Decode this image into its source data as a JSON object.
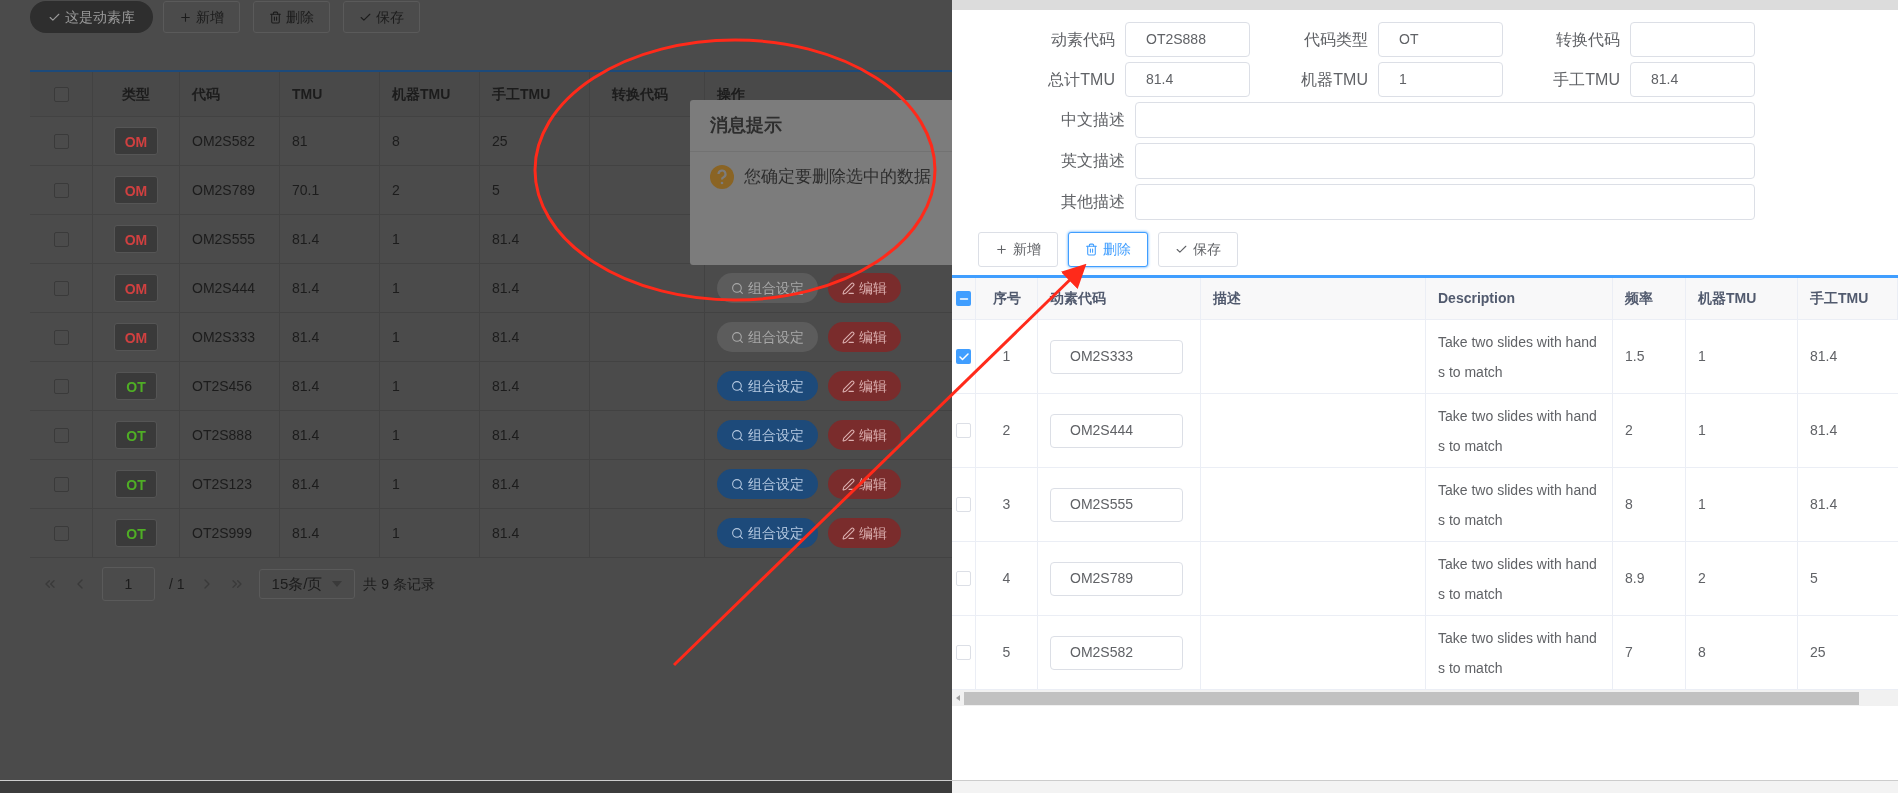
{
  "toolbar": {
    "buttons": [
      {
        "kind": "library",
        "label": "这是动素库"
      },
      {
        "kind": "add",
        "label": "新增"
      },
      {
        "kind": "delete",
        "label": "删除"
      },
      {
        "kind": "save",
        "label": "保存"
      }
    ]
  },
  "table": {
    "header_checked": false,
    "columns": [
      "类型",
      "代码",
      "TMU",
      "机器TMU",
      "手工TMU",
      "转换代码",
      "操作"
    ],
    "rows": [
      {
        "checked": false,
        "type": {
          "label": "OM",
          "color": "#d04040"
        },
        "code": "OM2S582",
        "tmu": "81",
        "machine_tmu": "8",
        "manual_tmu": "25"
      },
      {
        "checked": false,
        "type": {
          "label": "OM",
          "color": "#d04040"
        },
        "code": "OM2S789",
        "tmu": "70.1",
        "machine_tmu": "2",
        "manual_tmu": "5"
      },
      {
        "checked": false,
        "type": {
          "label": "OM",
          "color": "#d04040"
        },
        "code": "OM2S555",
        "tmu": "81.4",
        "machine_tmu": "1",
        "manual_tmu": "81.4"
      },
      {
        "checked": false,
        "type": {
          "label": "OM",
          "color": "#d04040"
        },
        "code": "OM2S444",
        "tmu": "81.4",
        "machine_tmu": "1",
        "manual_tmu": "81.4",
        "actions": [
          {
            "kind": "combo",
            "label": "组合设定",
            "disabled": true
          },
          {
            "kind": "edit",
            "label": "编辑"
          }
        ]
      },
      {
        "checked": false,
        "type": {
          "label": "OM",
          "color": "#d04040"
        },
        "code": "OM2S333",
        "tmu": "81.4",
        "machine_tmu": "1",
        "manual_tmu": "81.4",
        "actions": [
          {
            "kind": "combo",
            "label": "组合设定",
            "disabled": true
          },
          {
            "kind": "edit",
            "label": "编辑"
          }
        ]
      },
      {
        "checked": false,
        "type": {
          "label": "OT",
          "color": "#4fae25"
        },
        "code": "OT2S456",
        "tmu": "81.4",
        "machine_tmu": "1",
        "manual_tmu": "81.4",
        "actions": [
          {
            "kind": "combo",
            "label": "组合设定",
            "disabled": false
          },
          {
            "kind": "edit",
            "label": "编辑"
          }
        ]
      },
      {
        "checked": false,
        "type": {
          "label": "OT",
          "color": "#4fae25"
        },
        "code": "OT2S888",
        "tmu": "81.4",
        "machine_tmu": "1",
        "manual_tmu": "81.4",
        "actions": [
          {
            "kind": "combo",
            "label": "组合设定",
            "disabled": false
          },
          {
            "kind": "edit",
            "label": "编辑"
          }
        ]
      },
      {
        "checked": false,
        "type": {
          "label": "OT",
          "color": "#4fae25"
        },
        "code": "OT2S123",
        "tmu": "81.4",
        "machine_tmu": "1",
        "manual_tmu": "81.4",
        "actions": [
          {
            "kind": "combo",
            "label": "组合设定",
            "disabled": false
          },
          {
            "kind": "edit",
            "label": "编辑"
          }
        ]
      },
      {
        "checked": false,
        "type": {
          "label": "OT",
          "color": "#4fae25"
        },
        "code": "OT2S999",
        "tmu": "81.4",
        "machine_tmu": "1",
        "manual_tmu": "81.4",
        "actions": [
          {
            "kind": "combo",
            "label": "组合设定",
            "disabled": false
          },
          {
            "kind": "edit",
            "label": "编辑"
          }
        ]
      }
    ]
  },
  "pagination": {
    "page": "1",
    "total_pages": "/ 1",
    "page_size": "15条/页",
    "summary": "共 9 条记录"
  },
  "dialog": {
    "title": "消息提示",
    "message": "您确定要删除选中的数据"
  },
  "drawer": {
    "form_rows": [
      [
        {
          "label": "动素代码",
          "value": "OT2S888"
        },
        {
          "label": "代码类型",
          "value": "OT"
        },
        {
          "label": "转换代码"
        }
      ],
      [
        {
          "label": "总计TMU",
          "value": "81.4"
        },
        {
          "label": "机器TMU",
          "value": "1"
        },
        {
          "label": "手工TMU",
          "value": "81.4"
        }
      ]
    ],
    "text_areas": [
      {
        "label": "中文描述"
      },
      {
        "label": "英文描述"
      },
      {
        "label": "其他描述"
      }
    ],
    "buttons": [
      {
        "kind": "add",
        "label": "新增",
        "focused": false
      },
      {
        "kind": "delete",
        "label": "删除",
        "focused": true
      },
      {
        "kind": "save",
        "label": "保存",
        "focused": false
      }
    ],
    "table": {
      "header_indeterminate": true,
      "columns": [
        "序号",
        "动素代码",
        "描述",
        "Description",
        "频率",
        "机器TMU",
        "手工TMU"
      ],
      "rows": [
        {
          "checked": true,
          "index": "1",
          "code": "OM2S333",
          "description": "Take two slides with hands to match",
          "frequency": "1.5",
          "machine_tmu": "1",
          "manual_tmu": "81.4"
        },
        {
          "checked": false,
          "index": "2",
          "code": "OM2S444",
          "description": "Take two slides with hands to match",
          "frequency": "2",
          "machine_tmu": "1",
          "manual_tmu": "81.4"
        },
        {
          "checked": false,
          "index": "3",
          "code": "OM2S555",
          "description": "Take two slides with hands to match",
          "frequency": "8",
          "machine_tmu": "1",
          "manual_tmu": "81.4"
        },
        {
          "checked": false,
          "index": "4",
          "code": "OM2S789",
          "description": "Take two slides with hands to match",
          "frequency": "8.9",
          "machine_tmu": "2",
          "manual_tmu": "5"
        },
        {
          "checked": false,
          "index": "5",
          "code": "OM2S582",
          "description": "Take two slides with hands to match",
          "frequency": "7",
          "machine_tmu": "8",
          "manual_tmu": "25"
        }
      ]
    }
  }
}
